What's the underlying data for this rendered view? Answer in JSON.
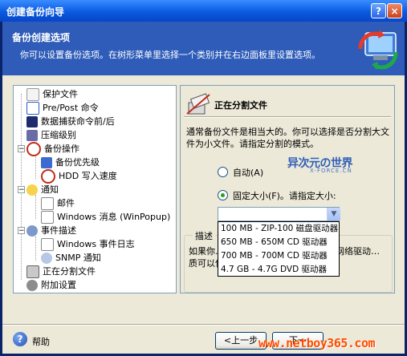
{
  "window": {
    "title": "创建备份向导",
    "help_glyph": "?",
    "close_glyph": "×"
  },
  "header": {
    "title": "备份创建选项",
    "description": "你可以设置备份选项。在树形菜单里选择一个类别并在右边面板里设置选项。"
  },
  "tree": {
    "items": [
      {
        "label": "保护文件",
        "icon": "lock-file-icon"
      },
      {
        "label": "Pre/Post 命令",
        "icon": "command-window-icon"
      },
      {
        "label": "数据捕获命令前/后",
        "icon": "console-icon"
      },
      {
        "label": "压缩级别",
        "icon": "compress-icon"
      },
      {
        "label": "备份操作",
        "icon": "backup-gear-icon"
      },
      {
        "label": "备份优先级",
        "icon": "priority-icon"
      },
      {
        "label": "HDD 写入速度",
        "icon": "hdd-icon"
      },
      {
        "label": "通知",
        "icon": "notify-icon"
      },
      {
        "label": "邮件",
        "icon": "mail-icon"
      },
      {
        "label": "Windows 消息 (WinPopup)",
        "icon": "winpopup-icon"
      },
      {
        "label": "事件描述",
        "icon": "events-icon"
      },
      {
        "label": "Windows 事件日志",
        "icon": "eventlog-icon"
      },
      {
        "label": "SNMP 通知",
        "icon": "snmp-icon"
      },
      {
        "label": "正在分割文件",
        "icon": "split-file-icon"
      },
      {
        "label": "附加设置",
        "icon": "settings-icon"
      }
    ]
  },
  "panel": {
    "title": "正在分割文件",
    "description": "通常备份文件是相当大的。你可以选择是否分割大文件为小文件。请指定分割的模式。",
    "auto_label": "自动(A)",
    "fixed_label": "固定大小(F)。请指定大小:",
    "combo_value": "",
    "options": [
      "100 MB - ZIP-100 磁盘驱动器",
      "650 MB - 650M CD 驱动器",
      "700 MB - 700M CD 驱动器",
      "4.7 GB - 4.7G DVD 驱动器"
    ],
    "desc_legend": "描述",
    "desc_text": "如果你… 选择该项。如… 固定硬盘或网络驱动… 质可以使用该模式。"
  },
  "watermark": {
    "name": "异次元の世界",
    "sub": "X-FORCE.CN"
  },
  "footer": {
    "help_label": "帮助",
    "help_glyph": "?",
    "back_label": "<上一步",
    "next_label": "下一",
    "netboy": "www.netboy365.com"
  },
  "colors": {
    "title_bar": "#0A5AE0",
    "header_band": "#2E5CB8",
    "face": "#ECE9D8",
    "watermark": "#2F5FB7",
    "netboy": "#FF4E00"
  }
}
